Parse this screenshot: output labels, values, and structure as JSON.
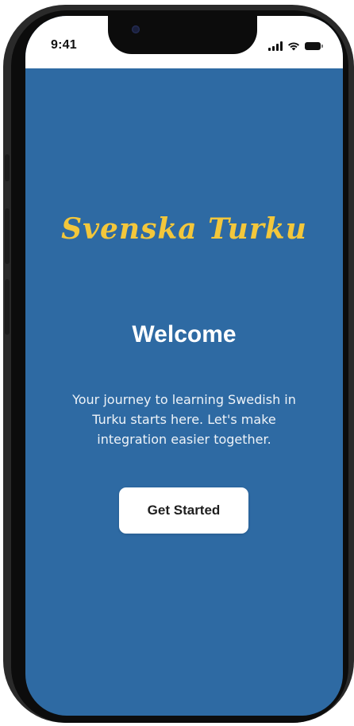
{
  "status_bar": {
    "time": "9:41",
    "icons": [
      "cellular-signal-icon",
      "wifi-icon",
      "battery-icon"
    ]
  },
  "app": {
    "title": "Svenska Turku",
    "title_color": "#f3c73b",
    "background_color": "#2e6aa3"
  },
  "welcome": {
    "heading": "Welcome",
    "body": "Your journey to learning Swedish in Turku starts here. Let's make integration easier together."
  },
  "actions": {
    "primary_label": "Get Started"
  }
}
